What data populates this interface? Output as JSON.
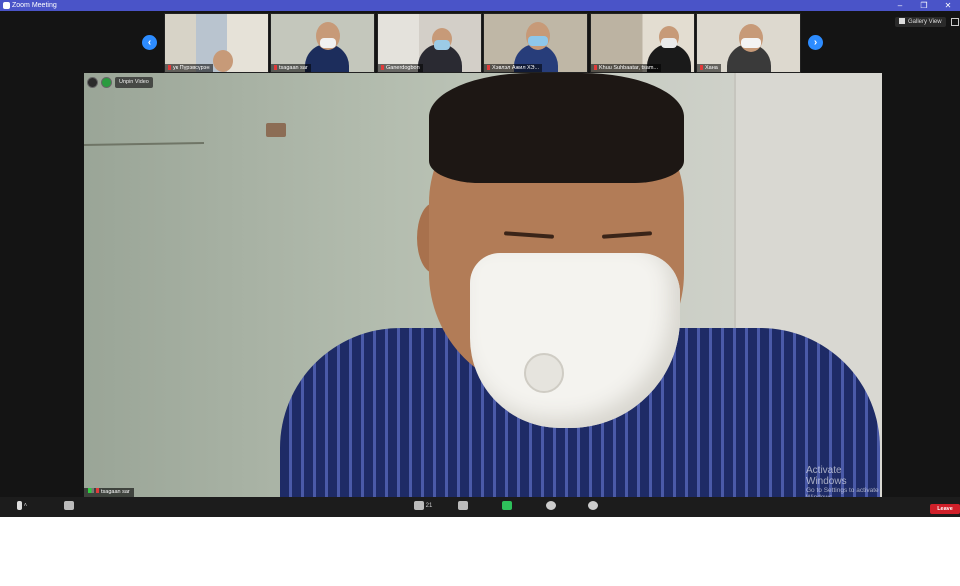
{
  "window": {
    "title": "Zoom Meeting",
    "minimize": "–",
    "maximize": "❐",
    "close": "✕"
  },
  "gallery": {
    "prev": "‹",
    "next": "›",
    "view_button": "Gallery View",
    "participants": [
      {
        "name": "ук Пүрэвсүрэн"
      },
      {
        "name": "tsagaan sar"
      },
      {
        "name": "Ganerdogbon"
      },
      {
        "name": "Хэвлэл Ажил ХЭ..."
      },
      {
        "name": "Khuu Suhbaatar, tsam..."
      },
      {
        "name": "Хана"
      }
    ]
  },
  "main_video": {
    "unpin_label": "Unpin Video",
    "speaker_name": "tsagaan sar"
  },
  "watermark": {
    "line1": "Activate Windows",
    "line2": "Go to Settings to activate Windows."
  },
  "toolbar": {
    "participants_count": "21",
    "leave_label": "Leave"
  },
  "colors": {
    "title_bar": "#4a54c8",
    "accent": "#2d8cff",
    "leave": "#d0202a",
    "share": "#2ec05b"
  }
}
